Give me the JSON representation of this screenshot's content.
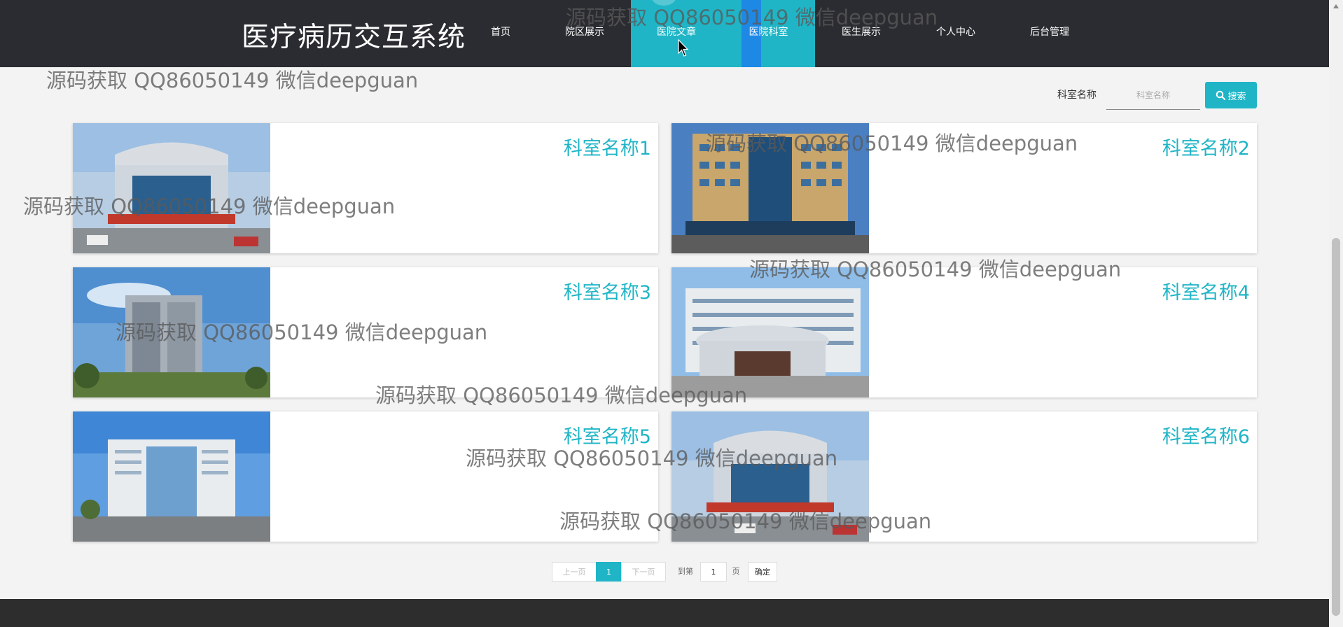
{
  "header": {
    "brand": "医疗病历交互系统",
    "nav": [
      {
        "label": "首页"
      },
      {
        "label": "院区展示"
      },
      {
        "label": "医院文章"
      },
      {
        "label": "医院科室"
      },
      {
        "label": "医生展示"
      },
      {
        "label": "个人中心"
      },
      {
        "label": "后台管理"
      }
    ]
  },
  "search": {
    "label": "科室名称",
    "placeholder": "科室名称",
    "button_label": "搜索",
    "button_icon": "search-icon"
  },
  "departments": [
    {
      "name": "科室名称1"
    },
    {
      "name": "科室名称2"
    },
    {
      "name": "科室名称3"
    },
    {
      "name": "科室名称4"
    },
    {
      "name": "科室名称5"
    },
    {
      "name": "科室名称6"
    }
  ],
  "pagination": {
    "prev": "上一页",
    "current": "1",
    "next": "下一页",
    "goto_prefix": "到第",
    "goto_value": "1",
    "goto_suffix": "页",
    "confirm": "确定"
  },
  "watermark": "源码获取 QQ86050149 微信deepguan",
  "colors": {
    "accent": "#1fb5c6",
    "header_bg": "#2a2c31",
    "nav_highlight": "#1e88e5",
    "footer_bg": "#2d2d2d"
  }
}
